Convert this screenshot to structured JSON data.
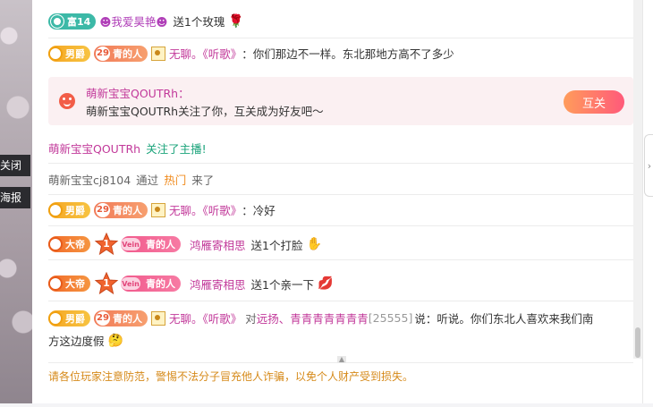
{
  "side": {
    "close_label": "关闭",
    "poster_label": "海报"
  },
  "messages": {
    "m1": {
      "badge": "富14",
      "user": "☻我爱昊艳☻",
      "action": "送1个玫瑰",
      "gift_icon": "rose-icon"
    },
    "m2": {
      "rank_badge": "男爵",
      "level_num": "29",
      "level_badge": "青的人",
      "user": "无聊。《听歌》",
      "colon": "：",
      "text": "你们那边不一样。东北那地方高不了多少"
    },
    "card": {
      "title": "萌新宝宝QOUTRh：",
      "body": "萌新宝宝QOUTRh关注了你，互关成为好友吧～",
      "button": "互关"
    },
    "m3": {
      "user": "萌新宝宝QOUTRh",
      "action": "关注了主播!"
    },
    "m4": {
      "user": "萌新宝宝cj8104",
      "pass": "通过",
      "source": "热门",
      "came": "来了"
    },
    "m5": {
      "rank_badge": "男爵",
      "level_num": "29",
      "level_badge": "青的人",
      "user": "无聊。《听歌》",
      "colon": "：",
      "text": "冷好"
    },
    "m6": {
      "rank_badge": "大帝",
      "star_num": "1",
      "fan_badge": "青的人",
      "fan_tag": "Vein",
      "user": "鸿雁寄相思",
      "action": "送1个打脸",
      "gift_icon": "slap-icon"
    },
    "m7": {
      "rank_badge": "大帝",
      "star_num": "1",
      "fan_badge": "青的人",
      "fan_tag": "Vein",
      "user": "鸿雁寄相思",
      "action": "送1个亲一下",
      "gift_icon": "kiss-icon"
    },
    "m8": {
      "rank_badge": "男爵",
      "level_num": "29",
      "level_badge": "青的人",
      "user": "无聊。《听歌》",
      "to": "对",
      "target": "远扬、青青青青青青青",
      "target_id": "[25555]",
      "says": "说：",
      "text_line1": "听说。你们东北人喜欢来我们南",
      "text_line2": "方这边度假"
    }
  },
  "notice": "请各位玩家注意防范，警惕不法分子冒充他人诈骗，以免个人财产受到损失。",
  "colors": {
    "accent_pink": "#c2399a",
    "accent_green": "#1aa37a",
    "notice_orange": "#d68a1a",
    "button_gradient_start": "#ff9c5b",
    "button_gradient_end": "#ff5a7a"
  }
}
